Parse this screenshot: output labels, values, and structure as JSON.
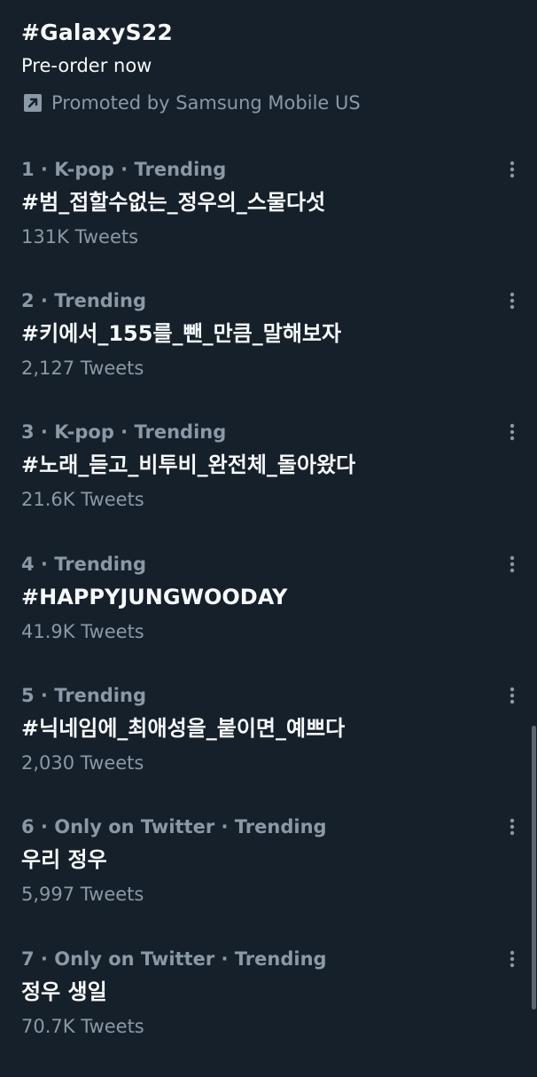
{
  "promoted": {
    "title": "#GalaxyS22",
    "subtitle": "Pre-order now",
    "promoted_by": "Promoted by Samsung Mobile US",
    "icon": "promoted-arrow-icon"
  },
  "trends": [
    {
      "meta": "1 · K-pop · Trending",
      "name": "#범_접할수없는_정우의_스물다섯",
      "count": "131K Tweets"
    },
    {
      "meta": "2 · Trending",
      "name": "#키에서_155를_뺀_만큼_말해보자",
      "count": "2,127 Tweets"
    },
    {
      "meta": "3 · K-pop · Trending",
      "name": "#노래_듣고_비투비_완전체_돌아왔다",
      "count": "21.6K Tweets"
    },
    {
      "meta": "4 · Trending",
      "name": "#HAPPYJUNGWOODAY",
      "count": "41.9K Tweets"
    },
    {
      "meta": "5 · Trending",
      "name": "#닉네임에_최애성을_붙이면_예쁘다",
      "count": "2,030 Tweets"
    },
    {
      "meta": "6 · Only on Twitter · Trending",
      "name": "우리 정우",
      "count": "5,997 Tweets"
    },
    {
      "meta": "7 · Only on Twitter · Trending",
      "name": "정우 생일",
      "count": "70.7K Tweets"
    }
  ],
  "colors": {
    "background": "#15202b",
    "primary_text": "#f7f9f9",
    "secondary_text": "#8b98a5"
  },
  "icons": {
    "more": "more-vertical-icon"
  }
}
